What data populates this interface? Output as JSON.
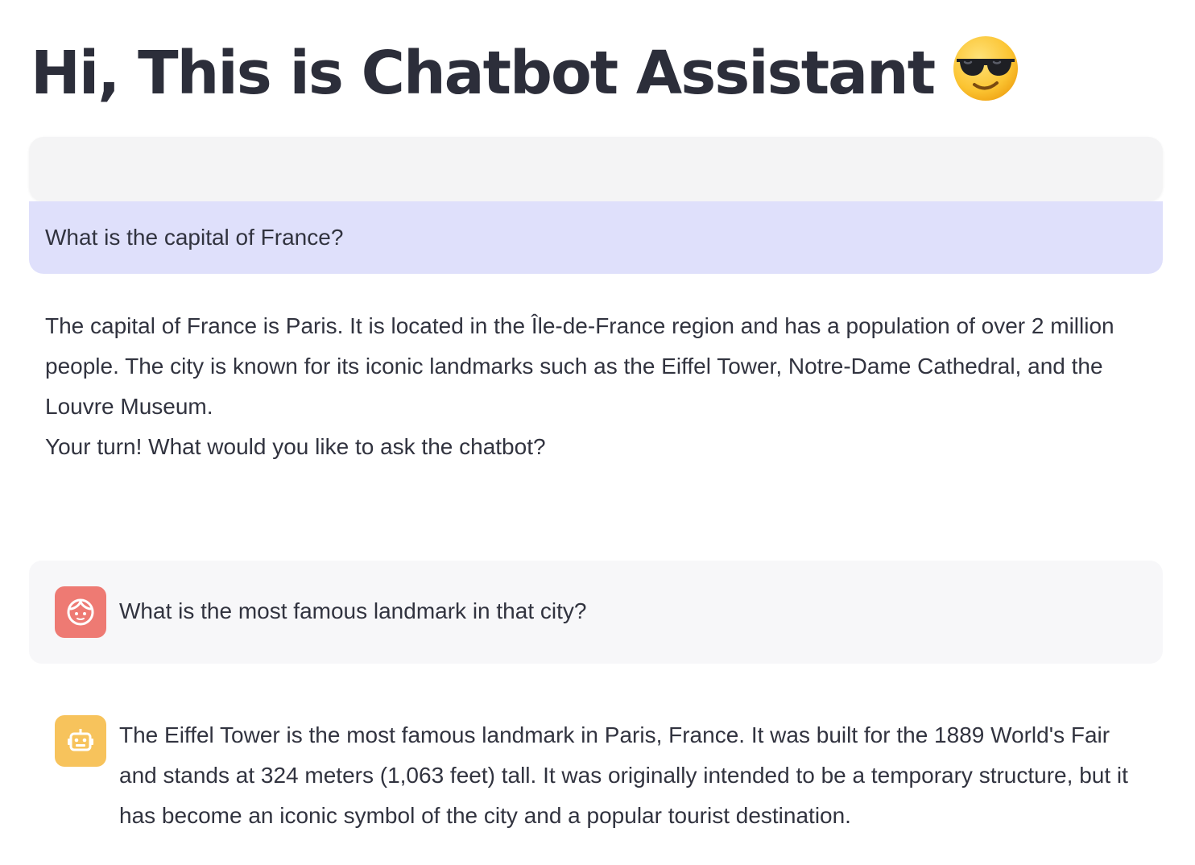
{
  "page": {
    "title": "Hi, This is Chatbot Assistant",
    "title_emoji": "smiling-face-with-sunglasses-icon"
  },
  "input": {
    "value": "",
    "placeholder": ""
  },
  "last_query": {
    "text": "What is the capital of France?"
  },
  "last_answer": {
    "paragraph": "The capital of France is Paris. It is located in the Île-de-France region and has a population of over 2 million people. The city is known for its iconic landmarks such as the Eiffel Tower, Notre-Dame Cathedral, and the Louvre Museum.",
    "prompt": "Your turn! What would you like to ask the chatbot?"
  },
  "chat": {
    "messages": [
      {
        "role": "user",
        "icon": "user-face-icon",
        "text": "What is the most famous landmark in that city?"
      },
      {
        "role": "assistant",
        "icon": "robot-icon",
        "text": "The Eiffel Tower is the most famous landmark in Paris, France. It was built for the 1889 World's Fair and stands at 324 meters (1,063 feet) tall. It was originally intended to be a temporary structure, but it has become an iconic symbol of the city and a popular tourist destination."
      }
    ]
  },
  "colors": {
    "user_avatar": "#ee7a73",
    "bot_avatar": "#f7c35c",
    "query_banner": "#dfe0fb",
    "user_message_bg": "#f7f7f9",
    "input_bg": "#f4f4f5",
    "text": "#31333f"
  }
}
